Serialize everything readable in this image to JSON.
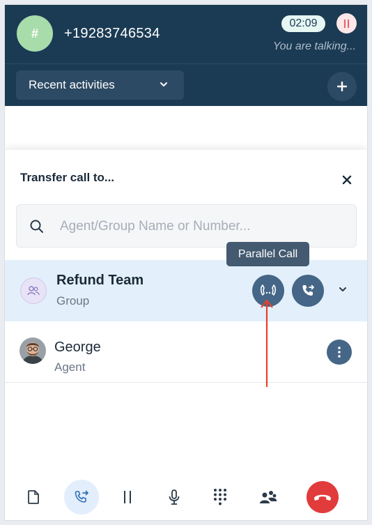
{
  "call": {
    "avatar_symbol": "#",
    "number": "+19283746534",
    "timer": "02:09",
    "status": "You are talking..."
  },
  "header": {
    "recent_label": "Recent activities"
  },
  "transfer": {
    "title": "Transfer call to...",
    "search_placeholder": "Agent/Group Name or Number...",
    "tooltip": "Parallel Call",
    "entries": [
      {
        "name": "Refund Team",
        "type": "Group"
      },
      {
        "name": "George",
        "type": "Agent"
      }
    ]
  },
  "toolbar": {
    "items": [
      "notes-icon",
      "transfer-icon",
      "hold-icon",
      "mic-icon",
      "dialpad-icon",
      "conference-icon",
      "end-call-icon"
    ]
  },
  "colors": {
    "header_bg": "#1b3b54",
    "accent": "#456686",
    "end_call": "#e23b3b",
    "highlight_row": "#e3f0fb",
    "annotation_arrow": "#e8402a"
  }
}
